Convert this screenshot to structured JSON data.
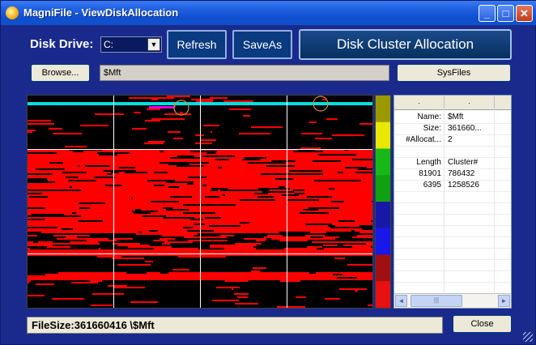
{
  "window": {
    "title": "MagniFile - ViewDiskAllocation"
  },
  "titlebar_buttons": {
    "minimize": "_",
    "maximize": "□",
    "close": "✕"
  },
  "toolbar": {
    "disk_drive_label": "Disk Drive:",
    "drive_value": "C:",
    "refresh_label": "Refresh",
    "saveas_label": "SaveAs",
    "title_button_label": "Disk Cluster Allocation",
    "browse_label": "Browse...",
    "path_value": "$Mft",
    "sysfiles_label": "SysFiles"
  },
  "grid": {
    "headers": [
      ".",
      "."
    ],
    "rows": [
      [
        "Name:",
        "$Mft"
      ],
      [
        "Size:",
        "361660..."
      ],
      [
        "#Allocat...",
        "2"
      ],
      [
        "",
        ""
      ],
      [
        "Length",
        "Cluster#"
      ],
      [
        "81901",
        "786432"
      ],
      [
        "6395",
        "1258526"
      ]
    ],
    "scroll_left_glyph": "◄",
    "scroll_right_glyph": "►",
    "scroll_thumb_glyph": "|||"
  },
  "legend": {
    "colors": [
      "#9a9a00",
      "#e8e800",
      "#18b818",
      "#10a010",
      "#1818a8",
      "#1818e8",
      "#a01010",
      "#e81010"
    ]
  },
  "map": {
    "used_color": "#ff0000",
    "free_color": "#000000",
    "selected_color": "#00e0e0",
    "highlight_color": "#e000e0"
  },
  "status": {
    "text": "FileSize:361660416  \\$Mft"
  },
  "close_label": "Close"
}
